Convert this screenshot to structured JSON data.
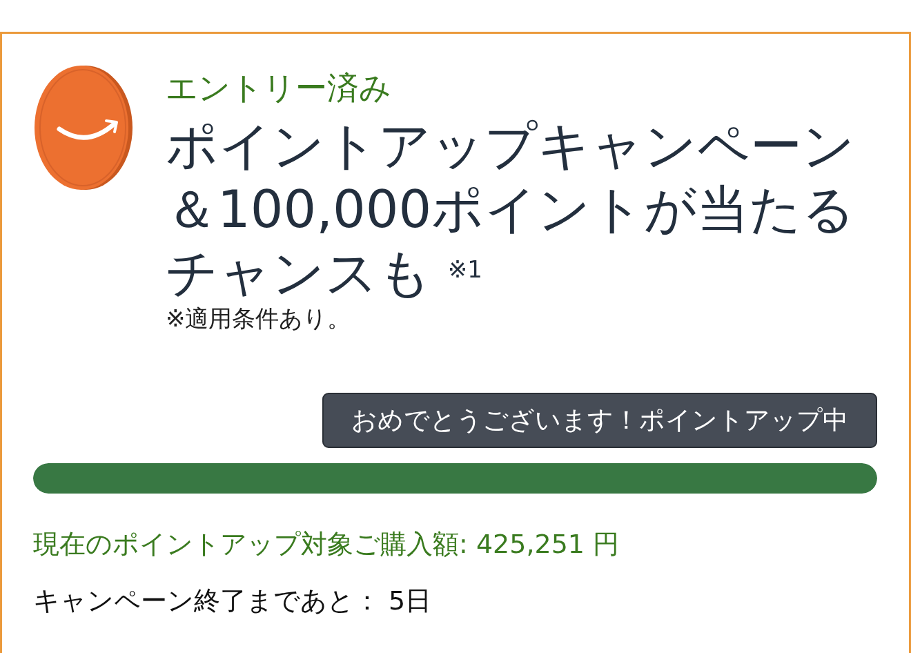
{
  "entry_status": "エントリー済み",
  "title": "ポイントアップキャンペーン＆100,000ポイントが当たるチャンスも $^{※1}$",
  "note": "※適用条件あり。",
  "status_message": "おめでとうございます！ポイントアップ中",
  "progress": {
    "level": 1
  },
  "purchase_amount": "現在のポイントアップ対象ご購入額: 425,251 円",
  "time_remaining": "キャンペーン終了まであと： 5日"
}
